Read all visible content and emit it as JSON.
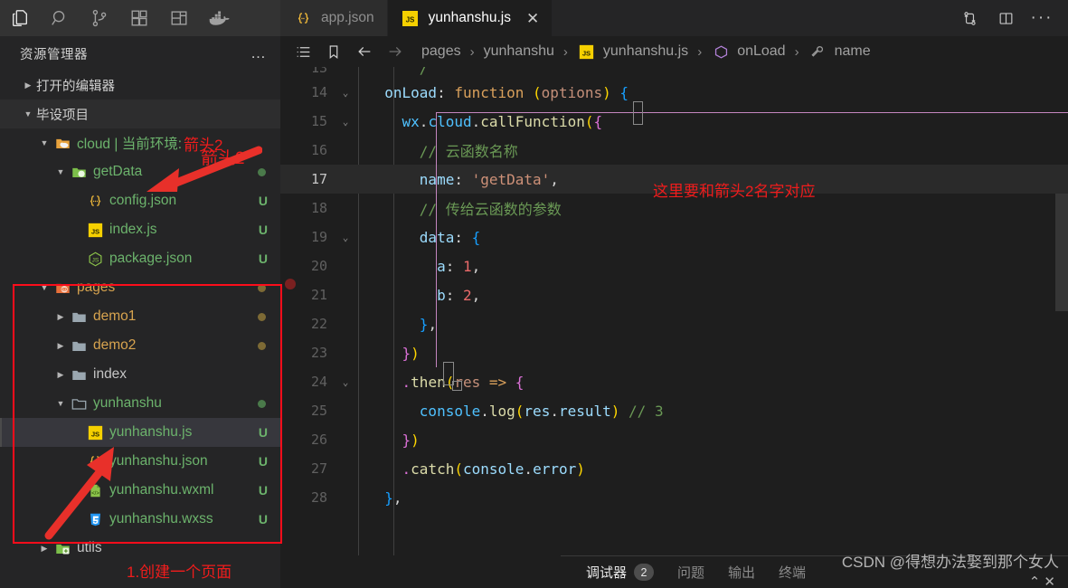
{
  "activity_bar": {
    "items": [
      {
        "name": "explorer-icon",
        "label": "资源管理器",
        "active": true
      },
      {
        "name": "search-icon",
        "label": "搜索",
        "active": false
      },
      {
        "name": "source-control-icon",
        "label": "源代码管理",
        "active": false
      },
      {
        "name": "extensions-icon",
        "label": "扩展",
        "active": false
      },
      {
        "name": "layout-icon",
        "label": "布局",
        "active": false
      },
      {
        "name": "docker-icon",
        "label": "Docker",
        "active": false
      }
    ]
  },
  "sidebar": {
    "title": "资源管理器",
    "more_label": "…",
    "sections": [
      {
        "label": "打开的编辑器",
        "expanded": false
      },
      {
        "label": "毕设项目",
        "expanded": true
      }
    ],
    "tree": [
      {
        "label": "cloud | 当前环境:",
        "suffix": "箭头2",
        "icon": "folder-cloud-icon",
        "indent": 1,
        "expanded": true,
        "color": "#6cb36c",
        "badge": "",
        "dot": ""
      },
      {
        "label": "getData",
        "icon": "folder-node-icon",
        "indent": 2,
        "expanded": true,
        "color": "#6cb36c",
        "badge": "",
        "dot": "#4a7a4a"
      },
      {
        "label": "config.json",
        "icon": "json-icon",
        "indent": 3,
        "color": "#6cb36c",
        "badge": "U",
        "dot": ""
      },
      {
        "label": "index.js",
        "icon": "js-icon",
        "indent": 3,
        "color": "#6cb36c",
        "badge": "U",
        "dot": ""
      },
      {
        "label": "package.json",
        "icon": "nodejs-icon",
        "indent": 3,
        "color": "#6cb36c",
        "badge": "U",
        "dot": ""
      },
      {
        "label": "pages",
        "icon": "folder-pages-icon",
        "indent": 1,
        "expanded": true,
        "color": "#d8a44f",
        "badge": "",
        "dot": "#7d6a35"
      },
      {
        "label": "demo1",
        "icon": "folder-icon",
        "indent": 2,
        "expanded": false,
        "color": "#d8a44f",
        "badge": "",
        "dot": "#7d6a35"
      },
      {
        "label": "demo2",
        "icon": "folder-icon",
        "indent": 2,
        "expanded": false,
        "color": "#d8a44f",
        "badge": "",
        "dot": "#7d6a35"
      },
      {
        "label": "index",
        "icon": "folder-icon",
        "indent": 2,
        "expanded": false,
        "color": "#c5c5c5",
        "badge": "",
        "dot": ""
      },
      {
        "label": "yunhanshu",
        "icon": "folder-open-icon",
        "indent": 2,
        "expanded": true,
        "color": "#6cb36c",
        "badge": "",
        "dot": "#4a7a4a"
      },
      {
        "label": "yunhanshu.js",
        "icon": "js-icon",
        "indent": 3,
        "color": "#6cb36c",
        "badge": "U",
        "dot": "",
        "selected": true
      },
      {
        "label": "yunhanshu.json",
        "icon": "json-icon",
        "indent": 3,
        "color": "#6cb36c",
        "badge": "U",
        "dot": ""
      },
      {
        "label": "yunhanshu.wxml",
        "icon": "wxml-icon",
        "indent": 3,
        "color": "#6cb36c",
        "badge": "U",
        "dot": ""
      },
      {
        "label": "yunhanshu.wxss",
        "icon": "wxss-icon",
        "indent": 3,
        "color": "#6cb36c",
        "badge": "U",
        "dot": ""
      },
      {
        "label": "utils",
        "icon": "folder-add-icon",
        "indent": 1,
        "expanded": false,
        "color": "#c5c5c5",
        "badge": "",
        "dot": ""
      }
    ]
  },
  "tabs": [
    {
      "label": "app.json",
      "icon": "json-icon",
      "active": false,
      "closable": false
    },
    {
      "label": "yunhanshu.js",
      "icon": "js-icon",
      "active": true,
      "closable": true,
      "close_glyph": "✕"
    }
  ],
  "tab_actions": [
    {
      "name": "compare-changes-icon"
    },
    {
      "name": "split-editor-icon"
    },
    {
      "name": "more-actions-icon"
    }
  ],
  "breadcrumbs": {
    "tools": [
      {
        "name": "outline-icon"
      },
      {
        "name": "bookmark-icon"
      },
      {
        "name": "back-arrow-icon"
      },
      {
        "name": "forward-arrow-icon"
      }
    ],
    "items": [
      {
        "label": "pages",
        "icon": ""
      },
      {
        "label": "yunhanshu",
        "icon": ""
      },
      {
        "label": "yunhanshu.js",
        "icon": "js-icon"
      },
      {
        "label": "onLoad",
        "icon": "symbol-method-icon"
      },
      {
        "label": "name",
        "icon": "symbol-property-icon"
      }
    ],
    "separator": "›"
  },
  "code": {
    "lines": [
      {
        "num": "13",
        "fold": "",
        "partial": true,
        "highlight": false,
        "tokens": [
          {
            "t": "      ",
            "c": "t-punc"
          },
          {
            "t": "/",
            "c": "t-com"
          }
        ]
      },
      {
        "num": "14",
        "fold": "⌄",
        "highlight": false,
        "tokens": [
          {
            "t": "  ",
            "c": "t-punc"
          },
          {
            "t": "onLoad",
            "c": "t-prop"
          },
          {
            "t": ": ",
            "c": "t-punc"
          },
          {
            "t": "function",
            "c": "t-kw"
          },
          {
            "t": " ",
            "c": "t-punc"
          },
          {
            "t": "(",
            "c": "t-br1"
          },
          {
            "t": "options",
            "c": "t-param"
          },
          {
            "t": ")",
            "c": "t-br1"
          },
          {
            "t": " ",
            "c": "t-punc"
          },
          {
            "t": "{",
            "c": "t-br3"
          }
        ]
      },
      {
        "num": "15",
        "fold": "⌄",
        "highlight": false,
        "tokens": [
          {
            "t": "    ",
            "c": "t-punc"
          },
          {
            "t": "wx",
            "c": "t-obj"
          },
          {
            "t": ".",
            "c": "t-punc"
          },
          {
            "t": "cloud",
            "c": "t-obj"
          },
          {
            "t": ".",
            "c": "t-punc"
          },
          {
            "t": "callFunction",
            "c": "t-fn"
          },
          {
            "t": "(",
            "c": "t-br1"
          },
          {
            "t": "{",
            "c": "t-br2"
          }
        ]
      },
      {
        "num": "16",
        "fold": "",
        "highlight": false,
        "tokens": [
          {
            "t": "      ",
            "c": "t-punc"
          },
          {
            "t": "// 云函数名称",
            "c": "t-com"
          }
        ]
      },
      {
        "num": "17",
        "fold": "",
        "highlight": true,
        "tokens": [
          {
            "t": "      ",
            "c": "t-punc"
          },
          {
            "t": "name",
            "c": "t-prop"
          },
          {
            "t": ": ",
            "c": "t-punc"
          },
          {
            "t": "'getData'",
            "c": "t-str"
          },
          {
            "t": ",",
            "c": "t-punc"
          }
        ]
      },
      {
        "num": "18",
        "fold": "",
        "highlight": false,
        "tokens": [
          {
            "t": "      ",
            "c": "t-punc"
          },
          {
            "t": "// 传给云函数的参数",
            "c": "t-com"
          }
        ]
      },
      {
        "num": "19",
        "fold": "⌄",
        "highlight": false,
        "tokens": [
          {
            "t": "      ",
            "c": "t-punc"
          },
          {
            "t": "data",
            "c": "t-prop"
          },
          {
            "t": ": ",
            "c": "t-punc"
          },
          {
            "t": "{",
            "c": "t-br3"
          }
        ]
      },
      {
        "num": "20",
        "fold": "",
        "highlight": false,
        "tokens": [
          {
            "t": "        ",
            "c": "t-punc"
          },
          {
            "t": "a",
            "c": "t-prop"
          },
          {
            "t": ": ",
            "c": "t-punc"
          },
          {
            "t": "1",
            "c": "t-num"
          },
          {
            "t": ",",
            "c": "t-punc"
          }
        ]
      },
      {
        "num": "21",
        "fold": "",
        "highlight": false,
        "tokens": [
          {
            "t": "        ",
            "c": "t-punc"
          },
          {
            "t": "b",
            "c": "t-prop"
          },
          {
            "t": ": ",
            "c": "t-punc"
          },
          {
            "t": "2",
            "c": "t-num"
          },
          {
            "t": ",",
            "c": "t-punc"
          }
        ]
      },
      {
        "num": "22",
        "fold": "",
        "highlight": false,
        "tokens": [
          {
            "t": "      ",
            "c": "t-punc"
          },
          {
            "t": "}",
            "c": "t-br3"
          },
          {
            "t": ",",
            "c": "t-punc"
          }
        ]
      },
      {
        "num": "23",
        "fold": "",
        "highlight": false,
        "tokens": [
          {
            "t": "    ",
            "c": "t-punc"
          },
          {
            "t": "}",
            "c": "t-br2"
          },
          {
            "t": ")",
            "c": "t-br1"
          }
        ]
      },
      {
        "num": "24",
        "fold": "⌄",
        "highlight": false,
        "tokens": [
          {
            "t": "    ",
            "c": "t-punc"
          },
          {
            "t": ".",
            "c": "t-br2"
          },
          {
            "t": "then",
            "c": "t-fn"
          },
          {
            "t": "(",
            "c": "t-br1"
          },
          {
            "t": "res",
            "c": "t-param"
          },
          {
            "t": " ",
            "c": "t-punc"
          },
          {
            "t": "=>",
            "c": "t-kw"
          },
          {
            "t": " ",
            "c": "t-punc"
          },
          {
            "t": "{",
            "c": "t-br2"
          }
        ]
      },
      {
        "num": "25",
        "fold": "",
        "highlight": false,
        "tokens": [
          {
            "t": "      ",
            "c": "t-punc"
          },
          {
            "t": "console",
            "c": "t-obj"
          },
          {
            "t": ".",
            "c": "t-punc"
          },
          {
            "t": "log",
            "c": "t-fn"
          },
          {
            "t": "(",
            "c": "t-br1"
          },
          {
            "t": "res",
            "c": "t-prop"
          },
          {
            "t": ".",
            "c": "t-punc"
          },
          {
            "t": "result",
            "c": "t-prop"
          },
          {
            "t": ")",
            "c": "t-br1"
          },
          {
            "t": " ",
            "c": "t-punc"
          },
          {
            "t": "// 3",
            "c": "t-com"
          }
        ]
      },
      {
        "num": "26",
        "fold": "",
        "highlight": false,
        "tokens": [
          {
            "t": "    ",
            "c": "t-punc"
          },
          {
            "t": "}",
            "c": "t-br2"
          },
          {
            "t": ")",
            "c": "t-br1"
          }
        ]
      },
      {
        "num": "27",
        "fold": "",
        "highlight": false,
        "tokens": [
          {
            "t": "    ",
            "c": "t-punc"
          },
          {
            "t": ".",
            "c": "t-br2"
          },
          {
            "t": "catch",
            "c": "t-fn"
          },
          {
            "t": "(",
            "c": "t-br1"
          },
          {
            "t": "console",
            "c": "t-prop"
          },
          {
            "t": ".",
            "c": "t-punc"
          },
          {
            "t": "error",
            "c": "t-prop"
          },
          {
            "t": ")",
            "c": "t-br1"
          }
        ]
      },
      {
        "num": "28",
        "fold": "",
        "highlight": false,
        "tokens": [
          {
            "t": "  ",
            "c": "t-punc"
          },
          {
            "t": "}",
            "c": "t-br3"
          },
          {
            "t": ",",
            "c": "t-punc"
          }
        ]
      }
    ]
  },
  "panel": {
    "tabs": [
      {
        "label": "调试器",
        "active": true,
        "count": "2"
      },
      {
        "label": "问题",
        "active": false,
        "count": ""
      },
      {
        "label": "输出",
        "active": false,
        "count": ""
      },
      {
        "label": "终端",
        "active": false,
        "count": ""
      }
    ]
  },
  "annotations": {
    "arrow2_label": "箭头2",
    "line17_note": "这里要和箭头2名字对应",
    "create_page_note": "1.创建一个页面",
    "accent_red": "#f01c1c",
    "box_red": "#fc0d1b"
  },
  "watermark": {
    "text": "CSDN @得想办法娶到那个女人",
    "chevrons": "⌃  ✕"
  }
}
